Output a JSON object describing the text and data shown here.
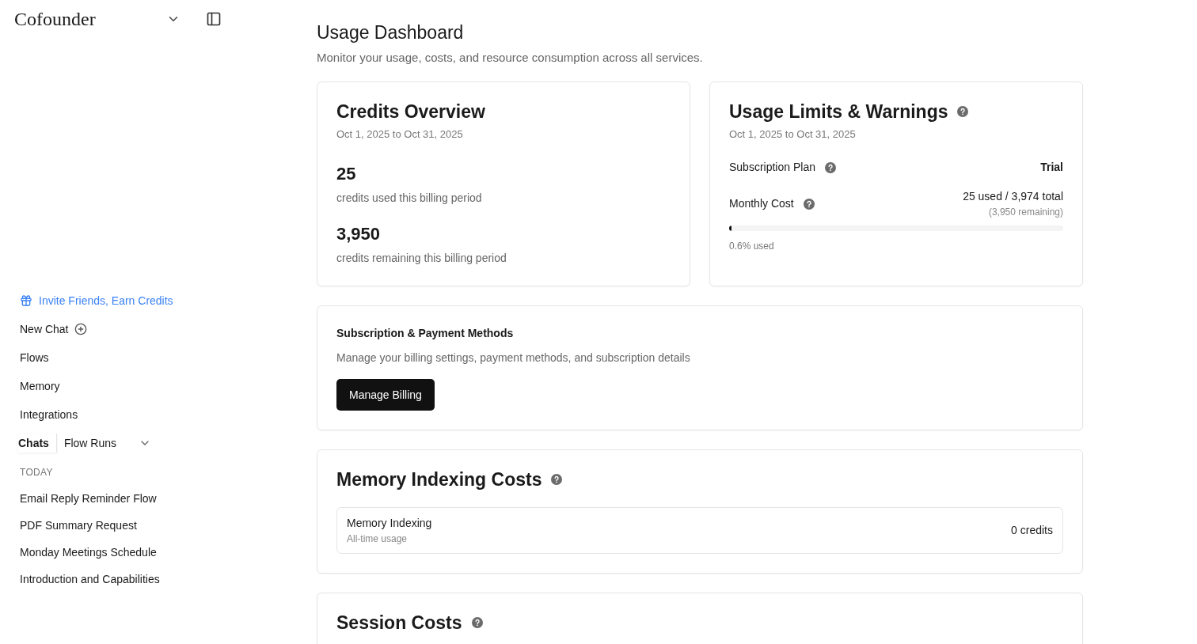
{
  "sidebar": {
    "brand": "Cofounder",
    "invite": "Invite Friends, Earn Credits",
    "nav": [
      {
        "label": "New Chat",
        "kind": "new"
      },
      {
        "label": "Flows",
        "kind": "link"
      },
      {
        "label": "Memory",
        "kind": "link"
      },
      {
        "label": "Integrations",
        "kind": "link"
      }
    ],
    "tabs": [
      {
        "label": "Chats",
        "selected": true
      },
      {
        "label": "Flow Runs",
        "selected": false
      }
    ],
    "section": "TODAY",
    "chats": [
      "Email Reply Reminder Flow",
      "PDF Summary Request",
      "Monday Meetings Schedule",
      "Introduction and Capabilities"
    ]
  },
  "page": {
    "title": "Usage Dashboard",
    "subtitle": "Monitor your usage, costs, and resource consumption across all services."
  },
  "credits": {
    "title": "Credits Overview",
    "period": "Oct 1, 2025 to Oct 31, 2025",
    "stats": [
      {
        "value": "25",
        "label": "credits used this billing period"
      },
      {
        "value": "3,950",
        "label": "credits remaining this billing period"
      }
    ]
  },
  "limits": {
    "title": "Usage Limits & Warnings",
    "period": "Oct 1, 2025 to Oct 31, 2025",
    "plan_label": "Subscription Plan",
    "plan": "Trial",
    "cost_label": "Monthly Cost",
    "cost": "25 used / 3,974 total",
    "remaining": "(3,950 remaining)",
    "level": 0.006,
    "used": "0.6% used"
  },
  "billing": {
    "title": "Subscription & Payment Methods",
    "description": "Manage your billing settings, payment methods, and subscription details",
    "button": "Manage Billing"
  },
  "memory": {
    "title": "Memory Indexing Costs",
    "row": {
      "name": "Memory Indexing",
      "note": "All-time usage",
      "value": "0 credits"
    }
  },
  "session": {
    "title": "Session Costs"
  }
}
